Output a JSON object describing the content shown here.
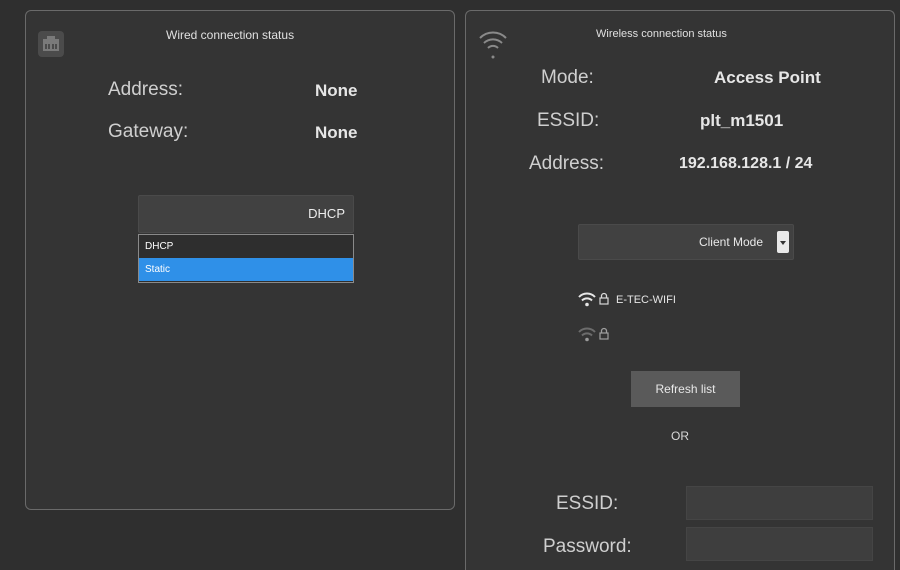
{
  "wired": {
    "title": "Wired connection status",
    "address_label": "Address:",
    "address_value": "None",
    "gateway_label": "Gateway:",
    "gateway_value": "None",
    "mode_select": {
      "value": "DHCP",
      "options": [
        "DHCP",
        "Static"
      ],
      "highlighted": "Static"
    }
  },
  "wireless": {
    "title": "Wireless connection status",
    "mode_label": "Mode:",
    "mode_value": "Access Point",
    "essid_label": "ESSID:",
    "essid_value": "plt_m1501",
    "address_label": "Address:",
    "address_value": "192.168.128.1 / 24",
    "client_mode_select": {
      "value": "Client Mode"
    },
    "networks": [
      {
        "name": "E-TEC-WIFI",
        "locked": true,
        "signal": "strong"
      },
      {
        "name": "",
        "locked": true,
        "signal": "weak"
      }
    ],
    "refresh_label": "Refresh list",
    "or_label": "OR",
    "manual_essid_label": "ESSID:",
    "manual_essid_value": "",
    "password_label": "Password:",
    "password_value": ""
  },
  "icons": {
    "wired": "ethernet-port-icon",
    "wireless": "wifi-icon",
    "signal": "wifi-signal-icon",
    "lock": "lock-icon",
    "dropdown": "chevron-down-icon"
  },
  "colors": {
    "background": "#2f2f2f",
    "panel_border": "#6a6a6a",
    "selection": "#2f90e8",
    "button": "#5a5a5a"
  }
}
